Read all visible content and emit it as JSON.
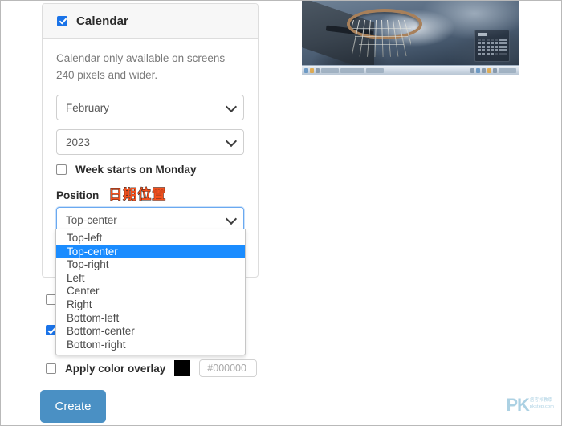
{
  "card": {
    "title": "Calendar",
    "title_checked": true,
    "help_text": "Calendar only available on screens 240 pixels and wider.",
    "month_select": {
      "value": "February",
      "icon": "chevron-down-icon"
    },
    "year_select": {
      "value": "2023",
      "icon": "chevron-down-icon"
    },
    "week_start": {
      "label": "Week starts on Monday",
      "checked": false
    },
    "position": {
      "label": "Position",
      "annotation": "日期位置",
      "annotation_color": "#f4511e",
      "selected": "Top-center",
      "options": [
        "Top-left",
        "Top-center",
        "Top-right",
        "Left",
        "Center",
        "Right",
        "Bottom-left",
        "Bottom-center",
        "Bottom-right"
      ],
      "highlighted_index": 1,
      "highlight_color": "#1a8cff"
    }
  },
  "below_card": {
    "hidden_row_a": {
      "checked": false
    },
    "hidden_row_b": {
      "checked": true
    },
    "overlay": {
      "label": "Apply color overlay",
      "checked": false,
      "swatch_color": "#000000",
      "hex_placeholder": "#000000"
    }
  },
  "actions": {
    "create_label": "Create",
    "create_color": "#4a90c4"
  },
  "preview": {
    "alt": "basketball-hoop-cloudy-sky-wallpaper-preview",
    "calendar_overlay": true,
    "taskbar": true
  },
  "watermark": {
    "logo": "PK",
    "line1": "痞客邦教學",
    "line2": "pkstep.com",
    "color": "#a8cfe2"
  }
}
